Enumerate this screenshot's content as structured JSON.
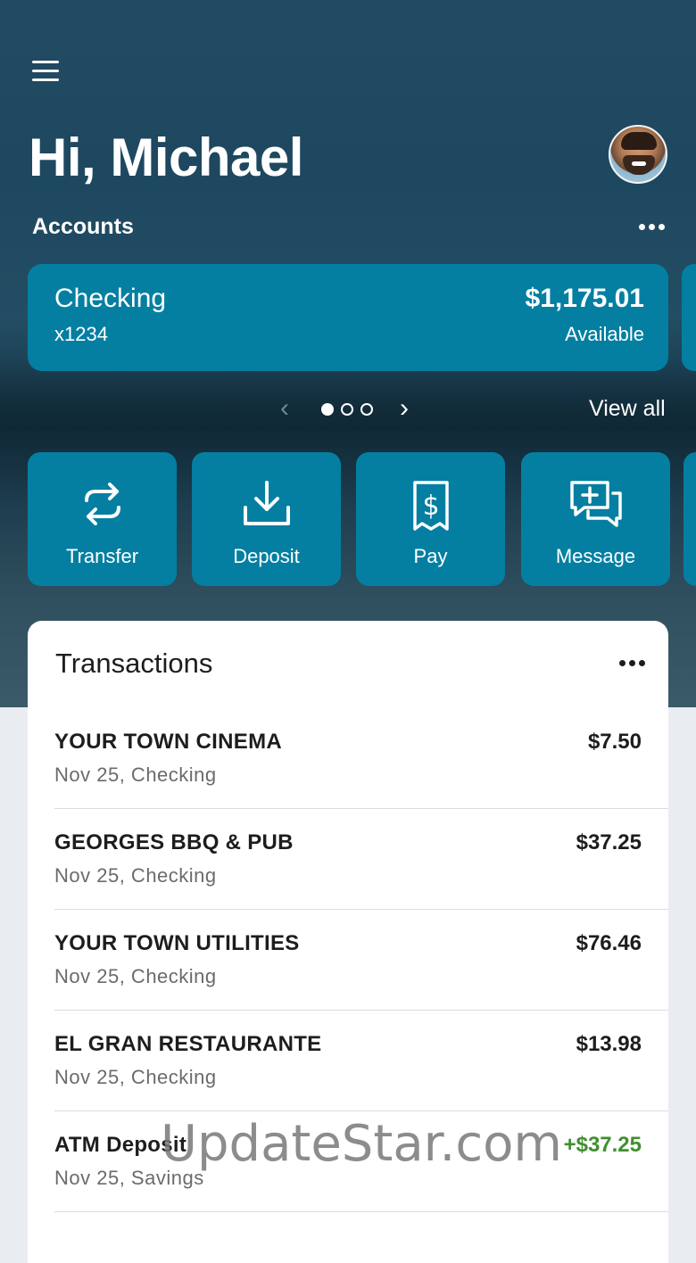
{
  "header": {
    "greeting": "Hi, Michael",
    "accounts_label": "Accounts",
    "view_all": "View all",
    "menu_icon": "hamburger-menu-icon",
    "more_icon": "ellipsis-icon"
  },
  "account": {
    "name": "Checking",
    "number": "x1234",
    "balance": "$1,175.01",
    "balance_label": "Available"
  },
  "pager": {
    "prev": "‹",
    "next": "›",
    "count": 3,
    "active_index": 0
  },
  "actions": [
    {
      "label": "Transfer",
      "icon": "transfer-arrows-icon"
    },
    {
      "label": "Deposit",
      "icon": "deposit-download-icon"
    },
    {
      "label": "Pay",
      "icon": "bill-dollar-icon"
    },
    {
      "label": "Message",
      "icon": "message-plus-icon"
    }
  ],
  "transactions": {
    "title": "Transactions",
    "items": [
      {
        "merchant": "YOUR TOWN CINEMA",
        "detail": "Nov 25, Checking",
        "amount": "$7.50"
      },
      {
        "merchant": "GEORGES BBQ & PUB",
        "detail": "Nov 25, Checking",
        "amount": "$37.25"
      },
      {
        "merchant": "YOUR TOWN UTILITIES",
        "detail": "Nov 25, Checking",
        "amount": "$76.46"
      },
      {
        "merchant": "EL GRAN RESTAURANTE",
        "detail": "Nov 25, Checking",
        "amount": "$13.98"
      },
      {
        "merchant": "ATM Deposit",
        "detail": "Nov 25, Savings",
        "amount": "+$37.25"
      }
    ]
  },
  "watermark": "UpdateStar.com",
  "colors": {
    "accent": "#047fa2",
    "credit": "#3f8f2e",
    "header_bg": "#1e4860"
  }
}
